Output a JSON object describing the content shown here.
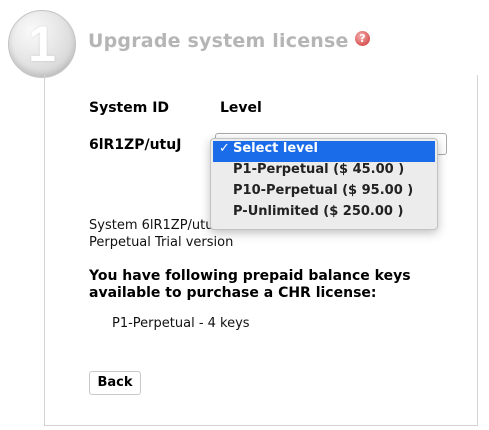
{
  "header": {
    "step_number": "1",
    "title": "Upgrade system license",
    "help_symbol": "?"
  },
  "table": {
    "col_system_id": "System ID",
    "col_level": "Level",
    "system_id_value": "6lR1ZP/utuJ"
  },
  "level_select": {
    "options": [
      {
        "label": "Select level",
        "selected": true
      },
      {
        "label": "P1-Perpetual ($ 45.00 )",
        "selected": false
      },
      {
        "label": "P10-Perpetual ($ 95.00 )",
        "selected": false
      },
      {
        "label": "P-Unlimited ($ 250.00 )",
        "selected": false
      }
    ],
    "check_mark": "✓"
  },
  "status": {
    "line1": "System 6lR1ZP/utu",
    "line2": "Perpetual Trial version"
  },
  "prepaid": {
    "heading_line1": "You have following prepaid balance keys",
    "heading_line2": "available to purchase a CHR license:",
    "item": "P1-Perpetual - 4 keys"
  },
  "actions": {
    "back_label": "Back"
  },
  "colors": {
    "title_gray": "#b5b5b5",
    "selected_blue": "#1b6ce8",
    "help_red": "#cc2f2f"
  }
}
